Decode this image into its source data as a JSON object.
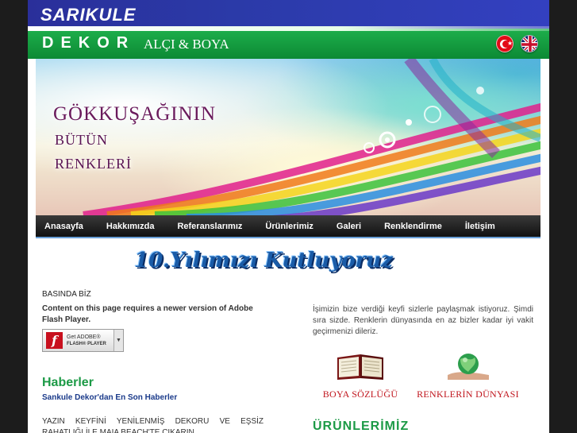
{
  "header": {
    "brand_top": "SARIKULE",
    "brand_bottom": "DEKOR",
    "brand_sub": "ALÇI & BOYA",
    "flags": [
      "turkish-flag-icon",
      "uk-flag-icon"
    ]
  },
  "banner": {
    "line1": "GÖKKUŞAĞININ",
    "line2": "BÜTÜN",
    "line3": "RENKLERİ"
  },
  "nav": {
    "items": [
      "Anasayfa",
      "Hakkımızda",
      "Referanslarımız",
      "Ürünlerimiz",
      "Galeri",
      "Renklendirme",
      "İletişim"
    ]
  },
  "anniversary": "10.Yılımızı Kutluyoruz",
  "left": {
    "basinda": "BASINDA BİZ",
    "flash_message": "Content on this page requires a newer version of Adobe Flash Player.",
    "flash_button_line1": "Get ADOBE®",
    "flash_button_line2": "FLASH® PLAYER",
    "haberler_title": "Haberler",
    "haberler_sub": "Sankule Dekor'dan En Son Haberler",
    "news_text": "YAZIN KEYFİNİ YENİLENMİŞ DEKORU VE EŞSİZ RAHATLIĞI İLE MAIA BEACH'TE ÇIKARIN."
  },
  "right": {
    "intro": "İşimizin bize verdiği keyfi sizlerle paylaşmak istiyoruz. Şimdi sıra sizde. Renklerin dünyasında en az bizler kadar iyi vakit geçirmenizi dileriz.",
    "promo1": "BOYA SÖZLÜĞÜ",
    "promo2": "RENKLERİN DÜNYASI",
    "urunler_title": "ÜRÜNLERİMİZ"
  },
  "colors": {
    "header_blue": "#2b3aa8",
    "header_green": "#12993e",
    "nav_bg": "#1a1a1a",
    "section_green": "#1c9a46",
    "promo_red": "#c0141c",
    "anniv_blue": "#1a5ca8"
  }
}
